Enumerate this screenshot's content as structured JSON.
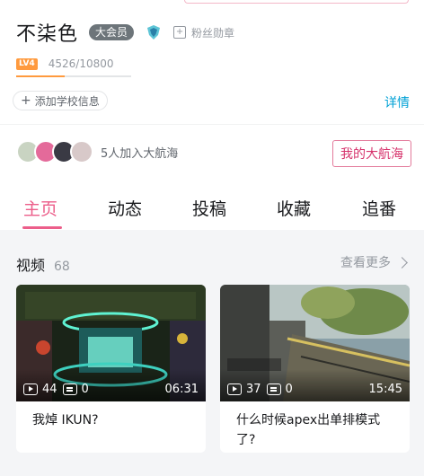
{
  "profile": {
    "username": "不柒色",
    "vip_label": "大会员",
    "medal_label": "粉丝勋章",
    "level_badge": "LV4",
    "exp_text": "4526/10800",
    "exp_progress": 0.419,
    "add_school_label": "添加学校信息",
    "detail_label": "详情"
  },
  "voyage": {
    "joined_text": "5人加入大航海",
    "button_label": "我的大航海"
  },
  "tabs": [
    {
      "label": "主页",
      "active": true
    },
    {
      "label": "动态",
      "active": false
    },
    {
      "label": "投稿",
      "active": false
    },
    {
      "label": "收藏",
      "active": false
    },
    {
      "label": "追番",
      "active": false
    }
  ],
  "videos_section": {
    "title": "视频",
    "count": "68",
    "more_label": "查看更多"
  },
  "videos": [
    {
      "plays": "44",
      "danmaku": "0",
      "duration": "06:31",
      "title": "我焯 IKUN?"
    },
    {
      "plays": "37",
      "danmaku": "0",
      "duration": "15:45",
      "title": "什么时候apex出单排模式了?"
    }
  ],
  "colors": {
    "accent_pink": "#ec5e8a",
    "link_blue": "#00a1d6",
    "level_orange": "#ff9a3e",
    "vip_gray": "#6d757a"
  }
}
